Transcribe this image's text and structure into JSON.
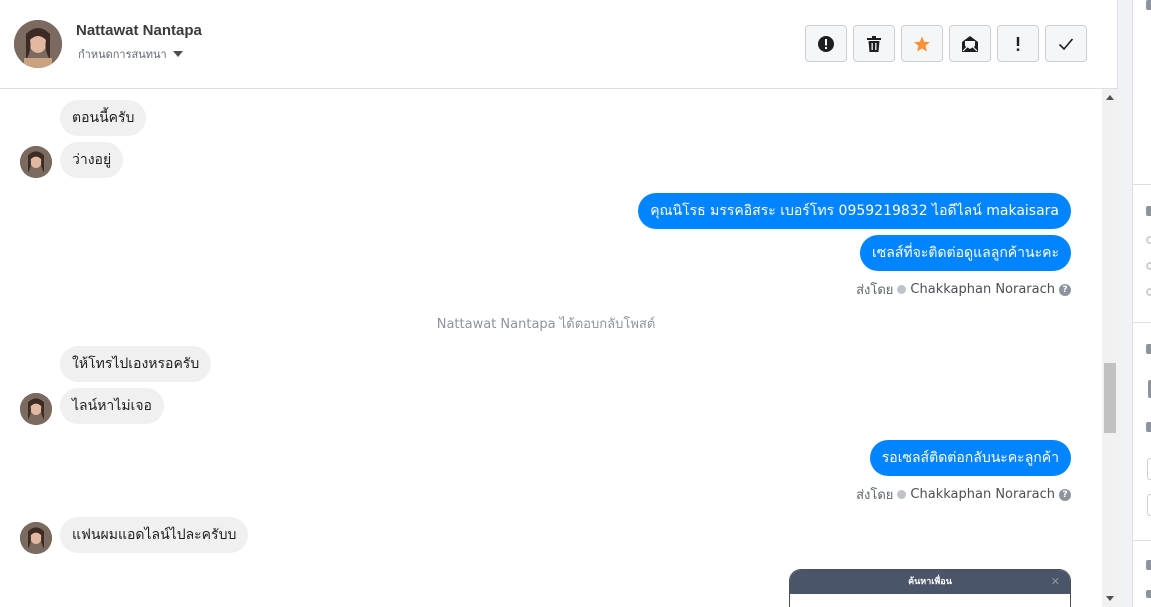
{
  "header": {
    "contact_name": "Nattawat Nantapa",
    "assign_label": "กำหนดการสนทนา",
    "toolbar": [
      {
        "name": "spam-button",
        "icon": "alert-circle-icon"
      },
      {
        "name": "delete-button",
        "icon": "trash-icon"
      },
      {
        "name": "star-button",
        "icon": "star-icon"
      },
      {
        "name": "mark-unread-button",
        "icon": "envelope-open-icon"
      },
      {
        "name": "follow-up-button",
        "icon": "exclamation-icon"
      },
      {
        "name": "done-button",
        "icon": "check-icon"
      }
    ]
  },
  "messages": {
    "m1": "ตอนนี้ครับ",
    "m2": "ว่างอยู่",
    "m3": "คุณนิโรธ มรรคอิสระ        เบอร์โทร 0959219832  ไอดีไลน์ makaisara",
    "m4": "เซลส์ที่จะติดต่อดูแลลูกค้านะคะ",
    "sent_by_1_prefix": "ส่งโดย",
    "sent_by_1_name": "Chakkaphan Norarach",
    "system_note": "Nattawat Nantapa ได้ตอบกลับโพสต์",
    "m5": "ให้โทรไปเองหรอครับ",
    "m6": "ไลน์หาไม่เจอ",
    "m7": "รอเซลส์ติดต่อกลับนะคะลูกค้า",
    "sent_by_2_prefix": "ส่งโดย",
    "sent_by_2_name": "Chakkaphan Norarach",
    "m8": "แฟนผมแอดไลน์ไปละครับบ"
  },
  "popup": {
    "title": "ค้นหาเพื่อน",
    "close": "✕"
  },
  "colors": {
    "outgoing_bubble": "#0084ff",
    "incoming_bubble": "#f1f0f0",
    "star": "#f7923a"
  }
}
